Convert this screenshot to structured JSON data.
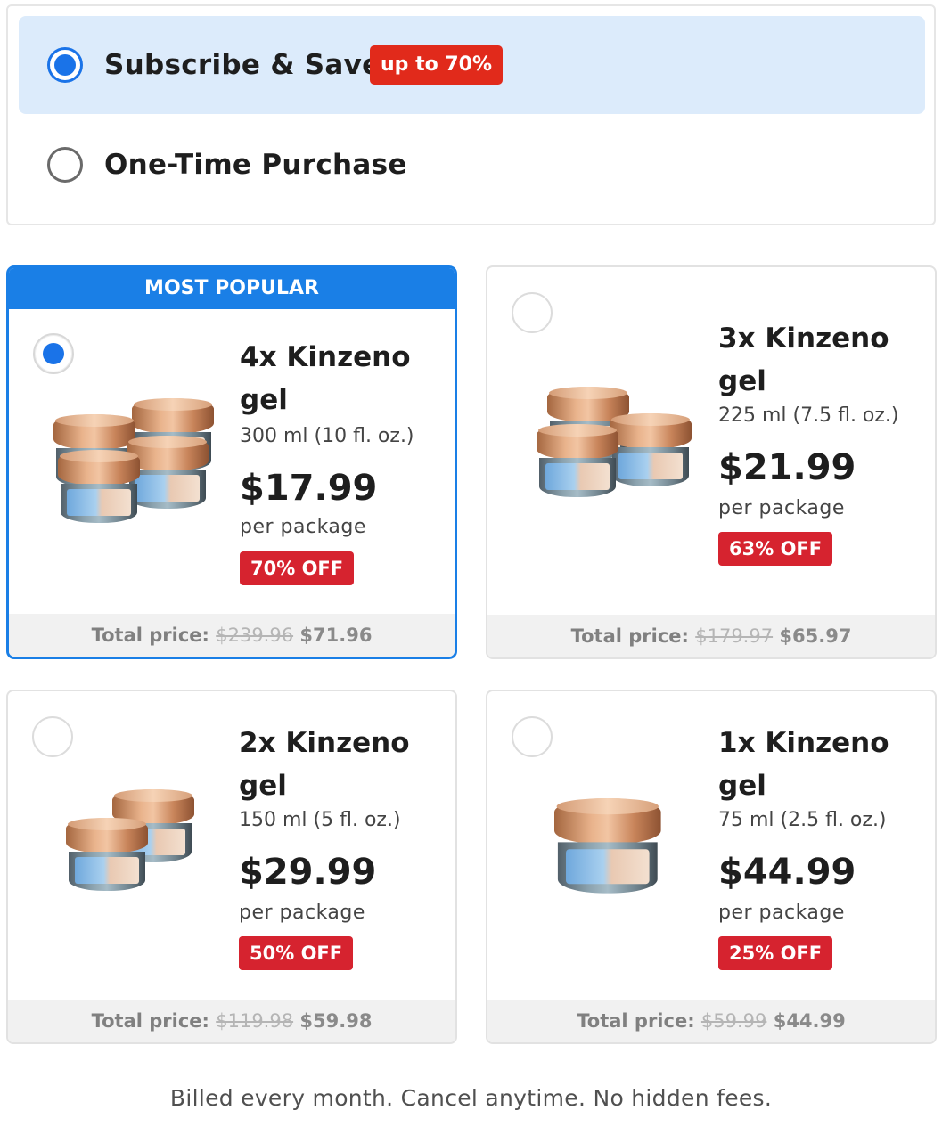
{
  "purchase_type": {
    "subscribe": {
      "label": "Subscribe & Save",
      "badge": "up to 70%",
      "selected": true
    },
    "one_time": {
      "label": "One-Time Purchase",
      "selected": false
    }
  },
  "products": [
    {
      "header": "MOST POPULAR",
      "name": "4x Kinzeno gel",
      "volume": "300 ml (10 fl. oz.)",
      "price": "$17.99",
      "per": "per package",
      "off": "70% OFF",
      "total_label": "Total price:",
      "old_total": "$239.96",
      "new_total": "$71.96",
      "selected": true,
      "jar_count": 4
    },
    {
      "name": "3x Kinzeno gel",
      "volume": "225 ml (7.5 fl. oz.)",
      "price": "$21.99",
      "per": "per package",
      "off": "63% OFF",
      "total_label": "Total price:",
      "old_total": "$179.97",
      "new_total": "$65.97",
      "selected": false,
      "jar_count": 3
    },
    {
      "name": "2x Kinzeno gel",
      "volume": "150 ml (5 fl. oz.)",
      "price": "$29.99",
      "per": "per package",
      "off": "50% OFF",
      "total_label": "Total price:",
      "old_total": "$119.98",
      "new_total": "$59.98",
      "selected": false,
      "jar_count": 2
    },
    {
      "name": "1x Kinzeno gel",
      "volume": "75 ml (2.5 fl. oz.)",
      "price": "$44.99",
      "per": "per package",
      "off": "25% OFF",
      "total_label": "Total price:",
      "old_total": "$59.99",
      "new_total": "$44.99",
      "selected": false,
      "jar_count": 1
    }
  ],
  "billing_note": "Billed every month. Cancel anytime. No hidden fees.",
  "colors": {
    "accent_blue": "#1a7fe6",
    "discount_red": "#d6232f",
    "badge_red": "#e12a1b",
    "selected_bg": "#dcebfb"
  }
}
